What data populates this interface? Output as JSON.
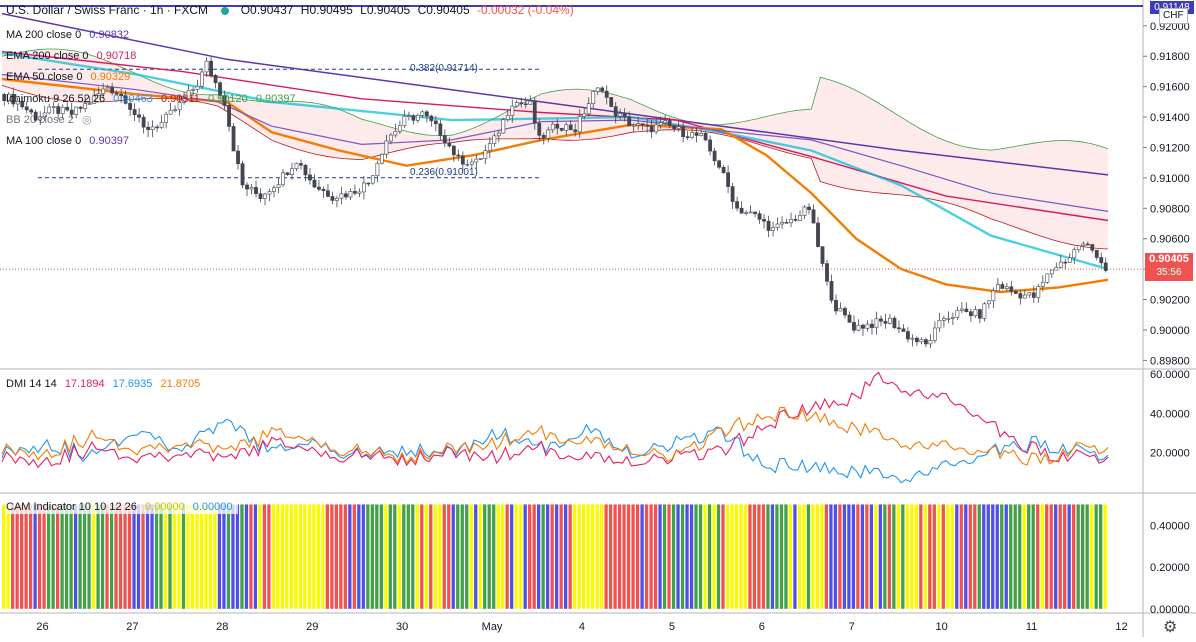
{
  "header": {
    "symbol": "U.S. Dollar / Swiss Franc · 1h · FXCM",
    "open": "O0.90437",
    "high": "H0.90495",
    "low": "L0.90405",
    "close": "C0.90405",
    "change": "-0.00032 (-0.04%)",
    "change_color": "#ef5350"
  },
  "indicator_legend": [
    {
      "label": "MA 200 close 0",
      "values": [
        "0.90832"
      ],
      "colors": [
        "#5e35b1"
      ]
    },
    {
      "label": "EMA 200 close 0",
      "values": [
        "0.90718"
      ],
      "colors": [
        "#d81b60"
      ]
    },
    {
      "label": "EMA 50 close 0",
      "values": [
        "0.90329"
      ],
      "colors": [
        "#f57c00"
      ]
    },
    {
      "label": "Ichimoku 9 26 52 26",
      "values": [
        "0.90463",
        "0.90311",
        "0.90120",
        "0.90397"
      ],
      "colors": [
        "#2196f3",
        "#b71c1c",
        "#43a047",
        "#43a047"
      ]
    },
    {
      "label": "BB 20 close 2",
      "values": [],
      "colors": []
    },
    {
      "label": "MA 100 close 0",
      "values": [
        "0.90397"
      ],
      "colors": [
        "#5e35b1"
      ]
    }
  ],
  "fib_labels": [
    {
      "text": "0.382(0.91714)",
      "level": 0.91714
    },
    {
      "text": "0.236(0.91001)",
      "level": 0.91001
    }
  ],
  "price_badge": {
    "price": "0.90405",
    "countdown": "35:56",
    "color": "#ef5350"
  },
  "top_badge": {
    "text": "0.91148",
    "color": "#3d3db8"
  },
  "currency": "CHF",
  "dmi_legend": {
    "label": "DMI 14 14",
    "values": [
      "17.1894",
      "17.6935",
      "21.8705"
    ],
    "colors": [
      "#e91e63",
      "#2196f3",
      "#f57c00"
    ]
  },
  "cam_legend": {
    "label": "CAM Indicator 10 10 12 26",
    "values": [
      "0.00000",
      "0.00000"
    ],
    "colors": [
      "#f9f900",
      "#2196f3"
    ]
  },
  "chart_data": {
    "type": "candlestick",
    "price_axis": {
      "min": 0.8975,
      "max": 0.9215,
      "ticks": [
        0.898,
        0.9,
        0.902,
        0.904,
        0.906,
        0.908,
        0.91,
        0.912,
        0.914,
        0.916,
        0.918,
        0.92
      ]
    },
    "dmi_axis": {
      "min": 0,
      "max": 62,
      "ticks": [
        20,
        40,
        60
      ]
    },
    "cam_axis": {
      "min": -0.02,
      "max": 0.55,
      "ticks": [
        0,
        0.2,
        0.4
      ]
    },
    "time_labels": [
      "26",
      "27",
      "28",
      "29",
      "30",
      "May",
      "4",
      "5",
      "6",
      "7",
      "10",
      "11",
      "12"
    ],
    "price_path": [
      [
        0,
        0.9155
      ],
      [
        4,
        0.915
      ],
      [
        8,
        0.914
      ],
      [
        12,
        0.9145
      ],
      [
        16,
        0.9142
      ],
      [
        20,
        0.915
      ],
      [
        24,
        0.916
      ],
      [
        28,
        0.9152
      ],
      [
        32,
        0.9132
      ],
      [
        36,
        0.9136
      ],
      [
        40,
        0.9148
      ],
      [
        44,
        0.9162
      ],
      [
        46,
        0.9175
      ],
      [
        50,
        0.915
      ],
      [
        52,
        0.912
      ],
      [
        54,
        0.9095
      ],
      [
        58,
        0.9088
      ],
      [
        62,
        0.9098
      ],
      [
        66,
        0.9112
      ],
      [
        70,
        0.9095
      ],
      [
        74,
        0.9088
      ],
      [
        78,
        0.909
      ],
      [
        82,
        0.9097
      ],
      [
        86,
        0.9125
      ],
      [
        90,
        0.9138
      ],
      [
        94,
        0.9142
      ],
      [
        98,
        0.913
      ],
      [
        102,
        0.9112
      ],
      [
        106,
        0.911
      ],
      [
        110,
        0.9125
      ],
      [
        114,
        0.915
      ],
      [
        118,
        0.9148
      ],
      [
        120,
        0.9125
      ],
      [
        124,
        0.9135
      ],
      [
        128,
        0.9132
      ],
      [
        132,
        0.9155
      ],
      [
        134,
        0.916
      ],
      [
        136,
        0.9145
      ],
      [
        140,
        0.9136
      ],
      [
        144,
        0.9132
      ],
      [
        148,
        0.9135
      ],
      [
        152,
        0.913
      ],
      [
        156,
        0.9127
      ],
      [
        160,
        0.9108
      ],
      [
        164,
        0.908
      ],
      [
        168,
        0.9075
      ],
      [
        172,
        0.9066
      ],
      [
        176,
        0.9072
      ],
      [
        180,
        0.908
      ],
      [
        184,
        0.903
      ],
      [
        186,
        0.9015
      ],
      [
        190,
        0.9002
      ],
      [
        194,
        0.9004
      ],
      [
        198,
        0.9006
      ],
      [
        202,
        0.8996
      ],
      [
        206,
        0.899
      ],
      [
        210,
        0.9008
      ],
      [
        214,
        0.9012
      ],
      [
        218,
        0.901
      ],
      [
        222,
        0.903
      ],
      [
        226,
        0.9024
      ],
      [
        230,
        0.9022
      ],
      [
        234,
        0.904
      ],
      [
        238,
        0.9048
      ],
      [
        240,
        0.9056
      ],
      [
        242,
        0.9055
      ],
      [
        244,
        0.905
      ],
      [
        246,
        0.904
      ]
    ],
    "ma200": [
      [
        0,
        0.9208
      ],
      [
        50,
        0.9178
      ],
      [
        100,
        0.9158
      ],
      [
        150,
        0.9138
      ],
      [
        200,
        0.9118
      ],
      [
        246,
        0.9102
      ]
    ],
    "ema200": [
      [
        0,
        0.9183
      ],
      [
        40,
        0.917
      ],
      [
        80,
        0.9152
      ],
      [
        120,
        0.9143
      ],
      [
        150,
        0.9138
      ],
      [
        180,
        0.9114
      ],
      [
        210,
        0.9088
      ],
      [
        246,
        0.9072
      ]
    ],
    "ma100": [
      [
        0,
        0.9182
      ],
      [
        30,
        0.9168
      ],
      [
        60,
        0.915
      ],
      [
        100,
        0.9138
      ],
      [
        140,
        0.914
      ],
      [
        160,
        0.913
      ],
      [
        180,
        0.9118
      ],
      [
        200,
        0.9095
      ],
      [
        220,
        0.9062
      ],
      [
        246,
        0.904
      ]
    ],
    "ema50": [
      [
        0,
        0.9165
      ],
      [
        30,
        0.9155
      ],
      [
        50,
        0.915
      ],
      [
        60,
        0.913
      ],
      [
        75,
        0.9118
      ],
      [
        90,
        0.9108
      ],
      [
        105,
        0.9115
      ],
      [
        120,
        0.9125
      ],
      [
        140,
        0.9135
      ],
      [
        160,
        0.9132
      ],
      [
        170,
        0.9115
      ],
      [
        180,
        0.909
      ],
      [
        190,
        0.906
      ],
      [
        200,
        0.904
      ],
      [
        210,
        0.903
      ],
      [
        222,
        0.9025
      ],
      [
        235,
        0.9028
      ],
      [
        246,
        0.9033
      ]
    ],
    "bb_mid": [
      [
        0,
        0.9168
      ],
      [
        30,
        0.9158
      ],
      [
        48,
        0.915
      ],
      [
        60,
        0.9134
      ],
      [
        80,
        0.9122
      ],
      [
        100,
        0.9125
      ],
      [
        120,
        0.9137
      ],
      [
        140,
        0.9138
      ],
      [
        160,
        0.9131
      ],
      [
        180,
        0.9125
      ],
      [
        200,
        0.9108
      ],
      [
        220,
        0.909
      ],
      [
        246,
        0.9078
      ]
    ],
    "fib_levels": [
      0.91714,
      0.91001
    ],
    "dmi": [
      {
        "name": "+DI",
        "color": "#2196f3",
        "values": [
          [
            0,
            20
          ],
          [
            10,
            25
          ],
          [
            20,
            18
          ],
          [
            30,
            32
          ],
          [
            40,
            22
          ],
          [
            50,
            35
          ],
          [
            60,
            20
          ],
          [
            70,
            25
          ],
          [
            80,
            18
          ],
          [
            90,
            22
          ],
          [
            100,
            20
          ],
          [
            110,
            30
          ],
          [
            120,
            22
          ],
          [
            130,
            32
          ],
          [
            140,
            20
          ],
          [
            150,
            25
          ],
          [
            160,
            30
          ],
          [
            170,
            14
          ],
          [
            180,
            12
          ],
          [
            190,
            10
          ],
          [
            200,
            8
          ],
          [
            210,
            12
          ],
          [
            220,
            20
          ],
          [
            230,
            25
          ],
          [
            240,
            20
          ],
          [
            246,
            18
          ]
        ]
      },
      {
        "name": "-DI",
        "color": "#e91e63",
        "values": [
          [
            0,
            18
          ],
          [
            10,
            16
          ],
          [
            20,
            22
          ],
          [
            30,
            18
          ],
          [
            40,
            20
          ],
          [
            50,
            16
          ],
          [
            60,
            25
          ],
          [
            70,
            20
          ],
          [
            80,
            18
          ],
          [
            90,
            17
          ],
          [
            100,
            20
          ],
          [
            110,
            18
          ],
          [
            120,
            22
          ],
          [
            130,
            18
          ],
          [
            140,
            16
          ],
          [
            150,
            18
          ],
          [
            160,
            20
          ],
          [
            170,
            35
          ],
          [
            180,
            42
          ],
          [
            190,
            48
          ],
          [
            195,
            58
          ],
          [
            205,
            50
          ],
          [
            215,
            42
          ],
          [
            225,
            25
          ],
          [
            235,
            18
          ],
          [
            246,
            17
          ]
        ]
      },
      {
        "name": "ADX",
        "color": "#f57c00",
        "values": [
          [
            0,
            22
          ],
          [
            10,
            20
          ],
          [
            20,
            28
          ],
          [
            30,
            22
          ],
          [
            40,
            25
          ],
          [
            50,
            20
          ],
          [
            60,
            30
          ],
          [
            70,
            25
          ],
          [
            80,
            20
          ],
          [
            90,
            18
          ],
          [
            100,
            22
          ],
          [
            110,
            25
          ],
          [
            120,
            30
          ],
          [
            130,
            26
          ],
          [
            140,
            22
          ],
          [
            150,
            18
          ],
          [
            160,
            30
          ],
          [
            170,
            40
          ],
          [
            180,
            38
          ],
          [
            190,
            32
          ],
          [
            200,
            26
          ],
          [
            210,
            22
          ],
          [
            220,
            20
          ],
          [
            230,
            16
          ],
          [
            240,
            22
          ],
          [
            246,
            22
          ]
        ]
      }
    ],
    "cam_pattern": [
      "#f9f900",
      "#f9f900",
      "#ef5350",
      "#ef5350",
      "#ef5350",
      "#5050e6",
      "#43a047",
      "#43a047",
      "#43a047",
      "#f9f900",
      "#ef5350",
      "#ef5350",
      "#5050e6",
      "#43a047",
      "#43a047",
      "#f9f900",
      "#f9f900",
      "#ef5350",
      "#5050e6",
      "#5050e6",
      "#43a047",
      "#ef5350",
      "#f9f900"
    ],
    "bar_count": 246
  }
}
